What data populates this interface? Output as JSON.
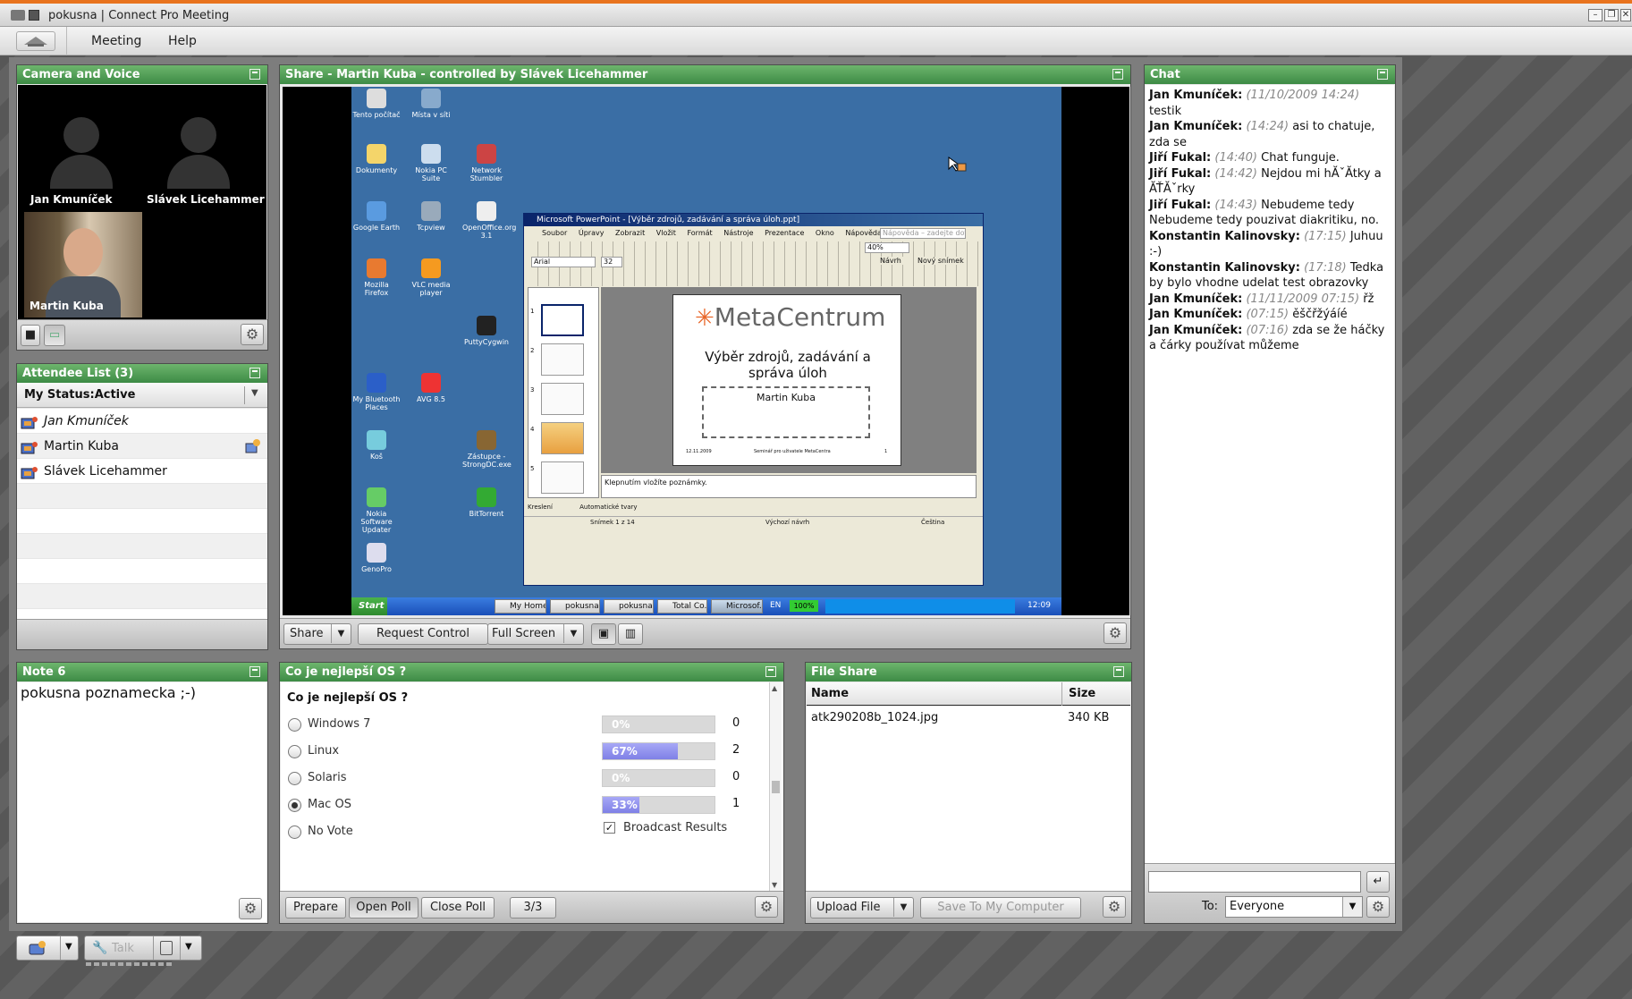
{
  "window": {
    "title": "pokusna | Connect Pro Meeting",
    "controls": [
      "–",
      "❐",
      "✕"
    ]
  },
  "menu": {
    "items": [
      "Meeting",
      "Help"
    ]
  },
  "camera_pod": {
    "title": "Camera and Voice",
    "people": [
      "Jan Kmuníček",
      "Slávek Licehammer"
    ],
    "video_name": "Martin Kuba"
  },
  "attendee_pod": {
    "title": "Attendee List (3)",
    "status": "My Status:Active",
    "attendees": [
      {
        "name": "Jan Kmuníček",
        "italic": true
      },
      {
        "name": "Martin Kuba",
        "italic": false
      },
      {
        "name": "Slávek Licehammer",
        "italic": false
      }
    ]
  },
  "share_pod": {
    "title": "Share - Martin Kuba - controlled by Slávek Licehammer",
    "buttons": {
      "share": "Share",
      "request_control": "Request Control",
      "full_screen": "Full Screen"
    },
    "ppt": {
      "title": "Microsoft PowerPoint - [Výběr zdrojů, zadávání a správa úloh.ppt]",
      "menu": [
        "Soubor",
        "Úpravy",
        "Zobrazit",
        "Vložit",
        "Formát",
        "Nástroje",
        "Prezentace",
        "Okno",
        "Nápověda"
      ],
      "help_box": "Nápověda – zadejte dotaz",
      "font": "Arial",
      "font_size": "32",
      "zoom": "40%",
      "new_slide": "Nový snímek",
      "design": "Návrh",
      "slide_logo": "MetaCentrum",
      "slide_title": "Výběr zdrojů, zadávání a správa úloh",
      "slide_author": "Martin Kuba",
      "slide_date": "12.11.2009",
      "slide_footer": "Seminář pro uživatele MetaCentra",
      "slide_num": "1",
      "notes": "Klepnutím vložíte poznámky.",
      "draw_label": "Kreslení",
      "autoshapes": "Automatické tvary",
      "status_slide": "Snímek 1 z 14",
      "status_design": "Výchozí návrh",
      "status_lang": "Čeština",
      "thumbs": [
        "1",
        "2",
        "3",
        "4",
        "5"
      ]
    },
    "desktop_icons": [
      "Tento počítač",
      "Místa v síti",
      "Dokumenty",
      "Nokia PC Suite",
      "Network Stumbler",
      "Google Earth",
      "Tcpview",
      "OpenOffice.org 3.1",
      "Mozilla Firefox",
      "VLC media player",
      "PuttyCygwin",
      "My Bluetooth Places",
      "AVG 8.5",
      "Koš",
      "Zástupce - StrongDC.exe",
      "Nokia Software Updater",
      "BitTorrent",
      "GenoPro"
    ],
    "taskbar": {
      "start": "Start",
      "tasks": [
        "My Home ...",
        "pokusna ...",
        "pokusna ...",
        "Total Co...",
        "Microsof..."
      ],
      "lang": "EN",
      "battery": "100%",
      "clock": "12:09"
    }
  },
  "chat_pod": {
    "title": "Chat",
    "messages": [
      {
        "user": "Jan Kmuníček:",
        "time": "(11/10/2009 14:24)",
        "text": "testik"
      },
      {
        "user": "Jan Kmuníček:",
        "time": "(14:24)",
        "text": "asi to chatuje, zda se"
      },
      {
        "user": "Jiří Fukal:",
        "time": "(14:40)",
        "text": "Chat funguje."
      },
      {
        "user": "Jiří Fukal:",
        "time": "(14:42)",
        "text": "Nejdou mi hĂˇĂtky a ĂŤĂˇrky"
      },
      {
        "user": "Jiří Fukal:",
        "time": "(14:43)",
        "text": "Nebudeme tedy Nebudeme tedy pouzivat diakritiku, no."
      },
      {
        "user": "Konstantin Kalinovsky:",
        "time": "(17:15)",
        "text": "Juhuu :-)"
      },
      {
        "user": "Konstantin Kalinovsky:",
        "time": "(17:18)",
        "text": "Tedka by bylo vhodne udelat test obrazovky"
      },
      {
        "user": "Jan Kmuníček:",
        "time": "(11/11/2009 07:15)",
        "text": "řž"
      },
      {
        "user": "Jan Kmuníček:",
        "time": "(07:15)",
        "text": "ěščřžýáíé"
      },
      {
        "user": "Jan Kmuníček:",
        "time": "(07:16)",
        "text": "zda se že háčky a čárky používat můžeme"
      }
    ],
    "to_label": "To:",
    "to_value": "Everyone"
  },
  "note_pod": {
    "title": "Note 6",
    "text": "pokusna poznamecka ;-)"
  },
  "poll_pod": {
    "title": "Co je nejlepší OS ?",
    "question": "Co je nejlepší OS ?",
    "options": [
      {
        "label": "Windows 7",
        "pct": 0,
        "pct_label": "0%",
        "votes": "0",
        "selected": false
      },
      {
        "label": "Linux",
        "pct": 67,
        "pct_label": "67%",
        "votes": "2",
        "selected": false
      },
      {
        "label": "Solaris",
        "pct": 0,
        "pct_label": "0%",
        "votes": "0",
        "selected": false
      },
      {
        "label": "Mac OS",
        "pct": 33,
        "pct_label": "33%",
        "votes": "1",
        "selected": true
      },
      {
        "label": "No Vote",
        "pct": null,
        "pct_label": "",
        "votes": "",
        "selected": false
      }
    ],
    "broadcast": "Broadcast Results",
    "buttons": {
      "prepare": "Prepare",
      "open": "Open Poll",
      "close": "Close Poll",
      "page": "3/3"
    }
  },
  "file_pod": {
    "title": "File Share",
    "columns": [
      "Name",
      "Size"
    ],
    "files": [
      {
        "name": "atk290208b_1024.jpg",
        "size": "340 KB"
      }
    ],
    "buttons": {
      "upload": "Upload File",
      "save": "Save To My Computer"
    }
  },
  "bottom_bar": {
    "talk": "Talk"
  }
}
